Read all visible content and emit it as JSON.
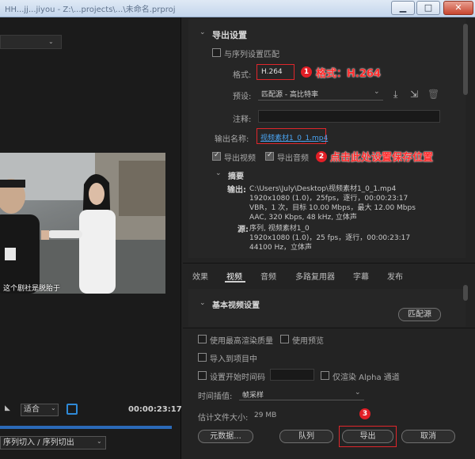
{
  "window": {
    "title": "HH...jj...jiyou - Z:\\...projects\\...\\未命名.prproj",
    "minimize": "▁",
    "maximize": "□",
    "close": "✕"
  },
  "source": {
    "subtitle": "这个剧社是脱胎于",
    "fit_label": "适合",
    "timecode": "00:00:23:17",
    "range_label": "序列切入 / 序列切出"
  },
  "export_settings": {
    "header": "导出设置",
    "match_sequence_label": "与序列设置匹配",
    "format_label": "格式:",
    "format_value": "H.264",
    "preset_label": "预设:",
    "preset_value": "匹配源 - 高比特率",
    "comment_label": "注释:",
    "output_name_label": "输出名称:",
    "output_name_value": "视频素材1_0_1.mp4",
    "export_video_label": "导出视频",
    "export_audio_label": "导出音频"
  },
  "summary": {
    "header": "摘要",
    "output_label": "输出:",
    "output_lines": [
      "C:\\Users\\July\\Desktop\\视频素材1_0_1.mp4",
      "1920x1080 (1.0)，25fps，逐行，00:00:23:17",
      "VBR，1 次，目标 10.00 Mbps，最大 12.00 Mbps",
      "AAC, 320 Kbps, 48  kHz, 立体声"
    ],
    "source_label": "源:",
    "source_lines": [
      "序列, 视频素材1_0",
      "1920x1080 (1.0)，25 fps，逐行，00:00:23:17",
      "44100 Hz，立体声"
    ]
  },
  "tabs": [
    "效果",
    "视频",
    "音频",
    "多路复用器",
    "字幕",
    "发布"
  ],
  "active_tab": "视频",
  "basic_video": {
    "header": "基本视频设置",
    "match_source_button": "匹配源"
  },
  "options": {
    "max_render_quality": "使用最高渲染质量",
    "use_previews": "使用预览",
    "import_into_project": "导入到项目中",
    "set_start_timecode": "设置开始时间码",
    "render_alpha_only": "仅渲染 Alpha 通道",
    "time_interp_label": "时间插值:",
    "time_interp_value": "帧采样",
    "file_size_label": "估计文件大小:",
    "file_size_value": "29 MB"
  },
  "buttons": {
    "metadata": "元数据...",
    "queue": "队列",
    "export": "导出",
    "cancel": "取消"
  },
  "annotations": {
    "step1_number": "1",
    "step1_text": "格式：H.264",
    "step2_number": "2",
    "step2_text": "点击此处设置保存位置",
    "step3_number": "3"
  },
  "icons": {
    "save_preset": "save-preset-icon",
    "import_preset": "import-preset-icon",
    "delete_preset": "delete-preset-icon"
  },
  "colors": {
    "annotation_red": "#e21e26",
    "link_blue": "#4aa3f0",
    "timeline_blue": "#2b6ab8"
  }
}
